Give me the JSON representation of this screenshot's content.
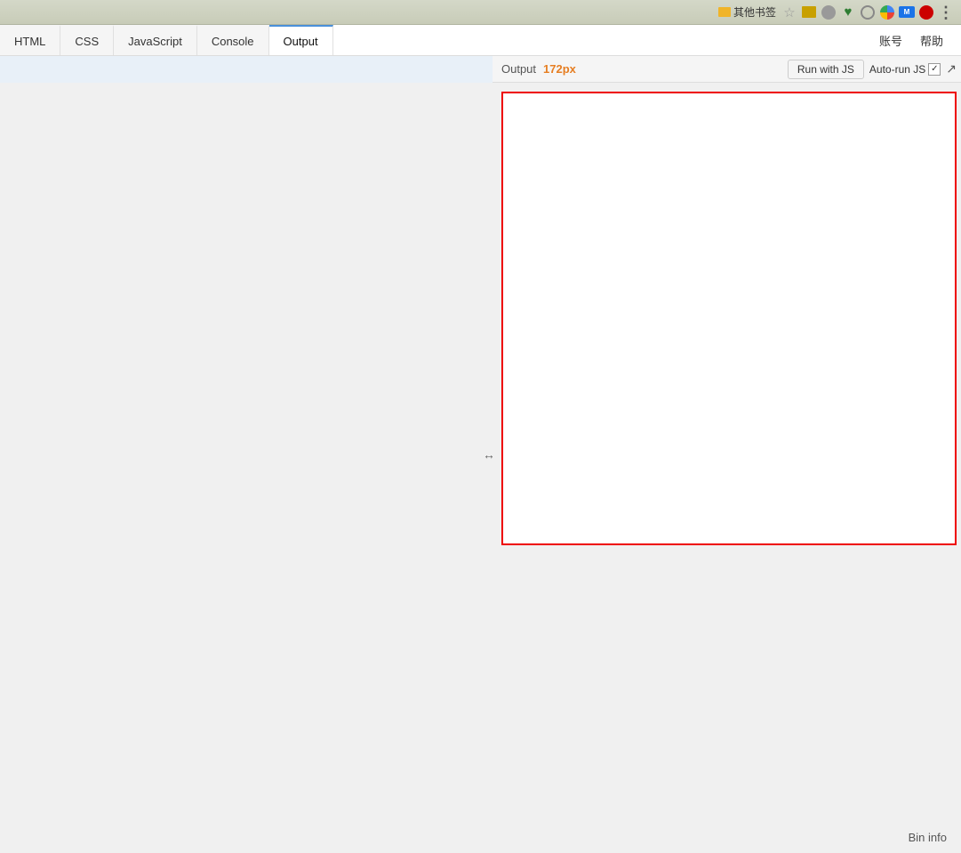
{
  "browser": {
    "icons": [
      "★",
      "📁",
      "⬤",
      "♥",
      "⬤",
      "🗺",
      "✉",
      "⬤",
      "⋮"
    ],
    "other_bookmarks_label": "其他书签"
  },
  "toolbar": {
    "tabs": [
      {
        "label": "HTML",
        "id": "html",
        "active": false
      },
      {
        "label": "CSS",
        "id": "css",
        "active": false
      },
      {
        "label": "JavaScript",
        "id": "javascript",
        "active": false
      },
      {
        "label": "Console",
        "id": "console",
        "active": false
      },
      {
        "label": "Output",
        "id": "output",
        "active": true
      }
    ],
    "account_label": "账号",
    "help_label": "帮助"
  },
  "output_panel": {
    "title": "Output",
    "size": "172px",
    "run_button_label": "Run with JS",
    "autorun_label": "Auto-run JS",
    "autorun_checked": true
  },
  "editor": {
    "resize_cursor": "↔"
  },
  "bin_info": {
    "label": "Bin info"
  }
}
